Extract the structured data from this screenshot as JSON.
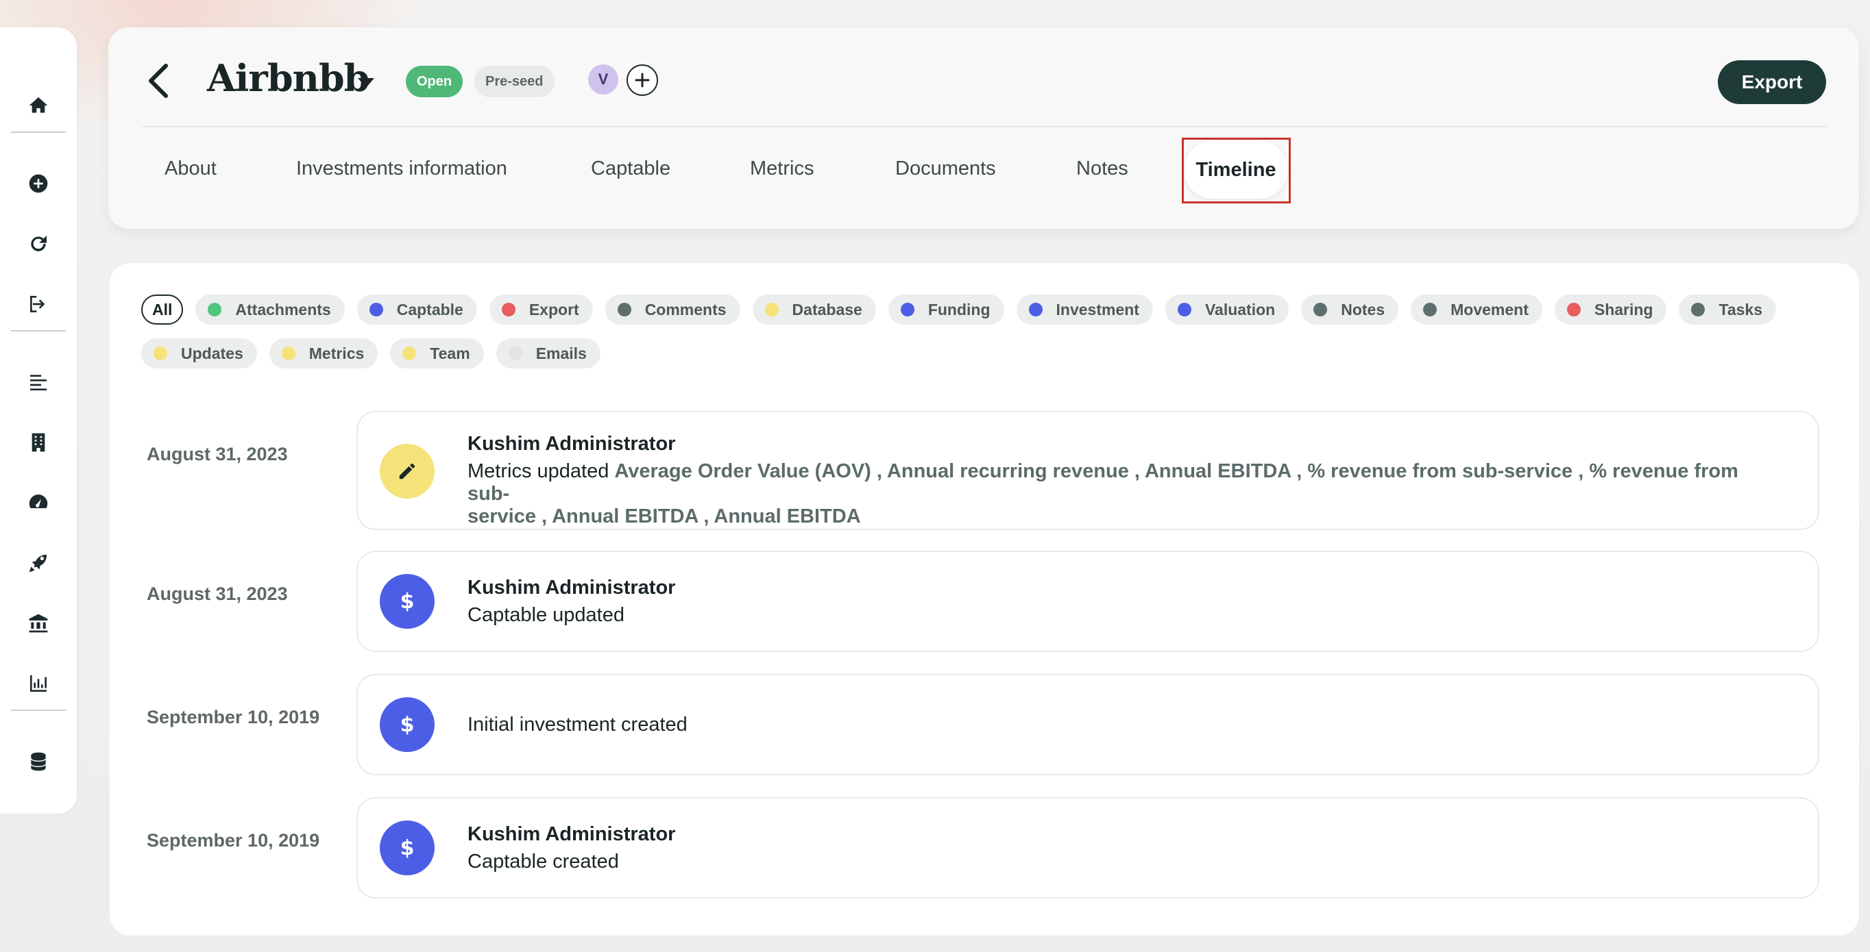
{
  "header": {
    "company_name": "Airbnbb",
    "status_badge": "Open",
    "stage_badge": "Pre-seed",
    "member_avatar_initial": "V",
    "export_label": "Export",
    "tabs": [
      "About",
      "Investments information",
      "Captable",
      "Metrics",
      "Documents",
      "Notes",
      "Timeline"
    ],
    "active_tab": "Timeline"
  },
  "filters": {
    "all_label": "All",
    "row1": [
      {
        "label": "Attachments",
        "color": "#4fc77f"
      },
      {
        "label": "Captable",
        "color": "#4d5ee6"
      },
      {
        "label": "Export",
        "color": "#e85c5c"
      },
      {
        "label": "Comments",
        "color": "#5f6f6e"
      },
      {
        "label": "Database",
        "color": "#f5e37a"
      },
      {
        "label": "Funding",
        "color": "#4d5ee6"
      },
      {
        "label": "Investment",
        "color": "#4d5ee6"
      },
      {
        "label": "Valuation",
        "color": "#4d5ee6"
      },
      {
        "label": "Notes",
        "color": "#5f6f6e"
      },
      {
        "label": "Movement",
        "color": "#5f6f6e"
      },
      {
        "label": "Sharing",
        "color": "#e85c5c"
      },
      {
        "label": "Tasks",
        "color": "#5f6f6e"
      }
    ],
    "row2": [
      {
        "label": "Updates",
        "color": "#f5e37a"
      },
      {
        "label": "Metrics",
        "color": "#f5e37a"
      },
      {
        "label": "Team",
        "color": "#f5e37a"
      },
      {
        "label": "Emails",
        "color": "#e2e4e4"
      }
    ]
  },
  "timeline": [
    {
      "date": "August 31, 2023",
      "icon": "pencil-icon",
      "author": "Kushim Administrator",
      "action": "Metrics updated",
      "metrics_line1": "Average Order Value (AOV) , Annual recurring revenue , Annual EBITDA , % revenue from sub-service , % revenue from sub-",
      "metrics_line2": "service , Annual EBITDA , Annual EBITDA"
    },
    {
      "date": "August 31, 2023",
      "icon": "dollar-icon",
      "author": "Kushim Administrator",
      "text": "Captable updated"
    },
    {
      "date": "September 10, 2019",
      "icon": "dollar-icon",
      "text": "Initial investment created"
    },
    {
      "date": "September 10, 2019",
      "icon": "dollar-icon",
      "author": "Kushim Administrator",
      "text": "Captable created"
    }
  ],
  "colors": {
    "accent_dark": "#1f3b37",
    "open_green": "#4fb878",
    "icon_yellow": "#f5e37a",
    "icon_blue": "#4d5ee6",
    "highlight_red": "#c9342a"
  }
}
